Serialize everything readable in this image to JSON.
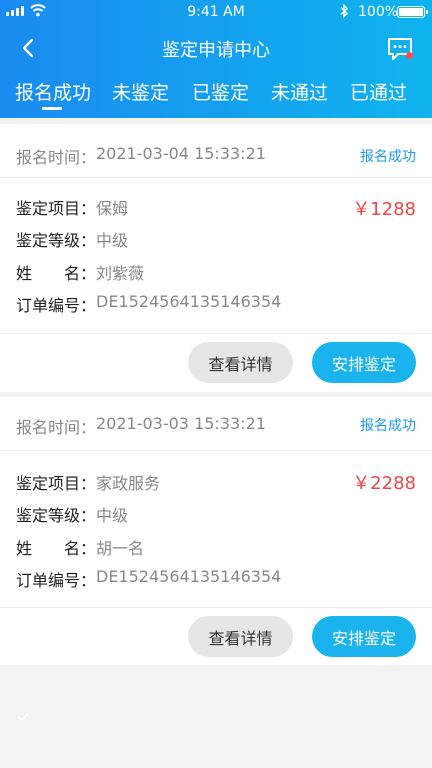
{
  "status_bar": {
    "time": "9:41 AM",
    "battery": "100%"
  },
  "header": {
    "title": "鉴定申请中心"
  },
  "tabs": [
    {
      "label": "报名成功",
      "active": true
    },
    {
      "label": "未鉴定",
      "active": false
    },
    {
      "label": "已鉴定",
      "active": false
    },
    {
      "label": "未通过",
      "active": false
    },
    {
      "label": "已通过",
      "active": false
    }
  ],
  "labels": {
    "apply_time": "报名时间：",
    "project": "鉴定项目：",
    "level": "鉴定等级：",
    "name_1": "姓",
    "name_2": "名：",
    "order_no": "订单编号：",
    "detail_button": "查看详情",
    "arrange_button": "安排鉴定"
  },
  "orders": [
    {
      "apply_time": "2021-03-04 15:33:21",
      "status": "报名成功",
      "project": "保姆",
      "level": "中级",
      "name": "刘紫薇",
      "order_no": "DE1524564135146354",
      "price": "￥1288"
    },
    {
      "apply_time": "2021-03-03 15:33:21",
      "status": "报名成功",
      "project": "家政服务",
      "level": "中级",
      "name": "胡一名",
      "order_no": "DE1524564135146354",
      "price": "￥2288"
    }
  ],
  "colors": {
    "header_start": "#1a8bf0",
    "header_end": "#0fb4ee",
    "price": "#f04545",
    "status_tag": "#1a9bf0",
    "arrange_button": "#1ab3ee"
  }
}
